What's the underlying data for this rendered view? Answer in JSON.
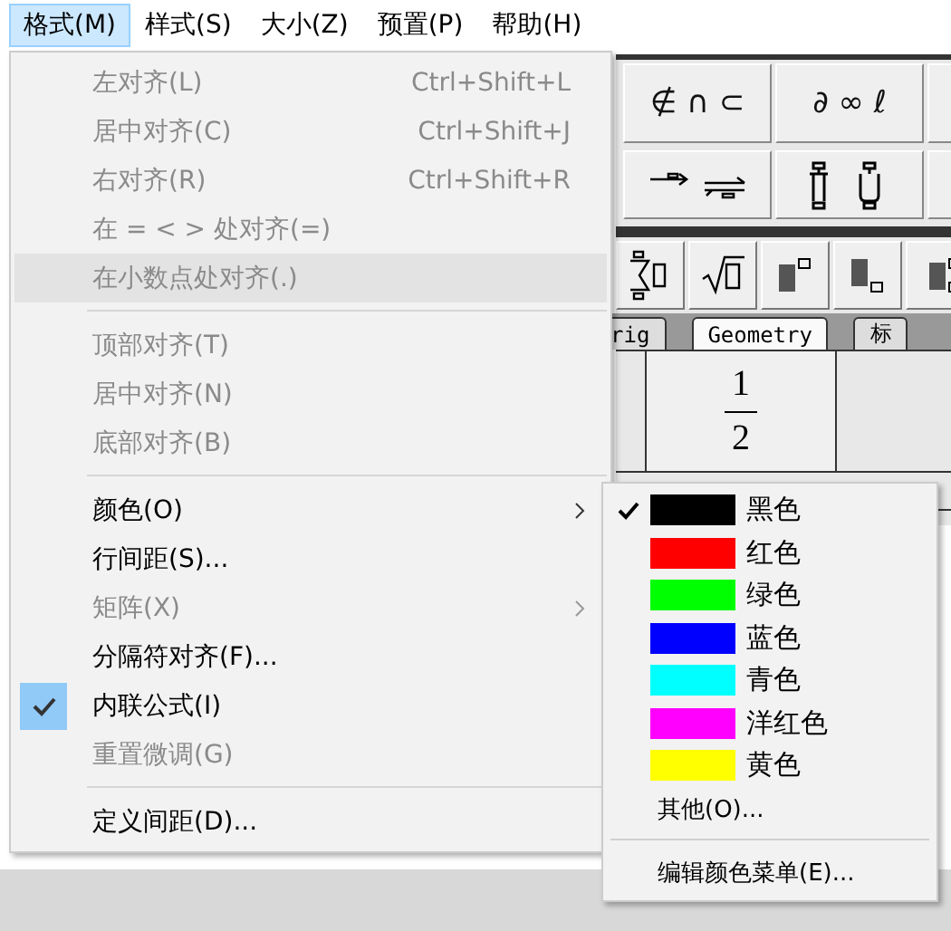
{
  "menu_bar": [
    {
      "label": "格式(M)",
      "selected": true
    },
    {
      "label": "样式(S)",
      "selected": false
    },
    {
      "label": "大小(Z)",
      "selected": false
    },
    {
      "label": "预置(P)",
      "selected": false
    },
    {
      "label": "帮助(H)",
      "selected": false
    }
  ],
  "palette": {
    "symbol_buttons": [
      "∉ ∩ ⊂",
      "∂ ∞ ℓ"
    ],
    "tabs": [
      {
        "label": "rig",
        "selected": false
      },
      {
        "label": "Geometry",
        "selected": true
      },
      {
        "label": "标",
        "selected": false
      }
    ],
    "fraction_template": {
      "numerator": "1",
      "denominator": "2"
    }
  },
  "format_menu": [
    {
      "kind": "item",
      "label": "左对齐(L)",
      "shortcut": "Ctrl+Shift+L",
      "disabled": true,
      "checked": false,
      "submenu": false,
      "highlighted": false
    },
    {
      "kind": "item",
      "label": "居中对齐(C)",
      "shortcut": "Ctrl+Shift+J",
      "disabled": true,
      "checked": false,
      "submenu": false,
      "highlighted": false
    },
    {
      "kind": "item",
      "label": "右对齐(R)",
      "shortcut": "Ctrl+Shift+R",
      "disabled": true,
      "checked": false,
      "submenu": false,
      "highlighted": false
    },
    {
      "kind": "item",
      "label": "在 = < > 处对齐(=)",
      "disabled": true,
      "checked": false,
      "submenu": false,
      "highlighted": false
    },
    {
      "kind": "item",
      "label": "在小数点处对齐(.)",
      "disabled": true,
      "checked": false,
      "submenu": false,
      "highlighted": true
    },
    {
      "kind": "separator"
    },
    {
      "kind": "item",
      "label": "顶部对齐(T)",
      "disabled": true,
      "checked": false,
      "submenu": false,
      "highlighted": false
    },
    {
      "kind": "item",
      "label": "居中对齐(N)",
      "disabled": true,
      "checked": false,
      "submenu": false,
      "highlighted": false
    },
    {
      "kind": "item",
      "label": "底部对齐(B)",
      "disabled": true,
      "checked": false,
      "submenu": false,
      "highlighted": false
    },
    {
      "kind": "separator"
    },
    {
      "kind": "item",
      "label": "颜色(O)",
      "disabled": false,
      "checked": false,
      "submenu": true,
      "highlighted": false
    },
    {
      "kind": "item",
      "label": "行间距(S)...",
      "disabled": false,
      "checked": false,
      "submenu": false,
      "highlighted": false
    },
    {
      "kind": "item",
      "label": "矩阵(X)",
      "disabled": true,
      "checked": false,
      "submenu": true,
      "highlighted": false
    },
    {
      "kind": "item",
      "label": "分隔符对齐(F)...",
      "disabled": false,
      "checked": false,
      "submenu": false,
      "highlighted": false
    },
    {
      "kind": "item",
      "label": "内联公式(I)",
      "disabled": false,
      "checked": true,
      "submenu": false,
      "highlighted": false
    },
    {
      "kind": "item",
      "label": "重置微调(G)",
      "disabled": true,
      "checked": false,
      "submenu": false,
      "highlighted": false
    },
    {
      "kind": "separator"
    },
    {
      "kind": "item",
      "label": "定义间距(D)...",
      "disabled": false,
      "checked": false,
      "submenu": false,
      "highlighted": false
    }
  ],
  "color_menu": [
    {
      "kind": "color",
      "label": "黑色",
      "color": "#000000",
      "checked": true
    },
    {
      "kind": "color",
      "label": "红色",
      "color": "#ff0000",
      "checked": false
    },
    {
      "kind": "color",
      "label": "绿色",
      "color": "#00ff00",
      "checked": false
    },
    {
      "kind": "color",
      "label": "蓝色",
      "color": "#0000ff",
      "checked": false
    },
    {
      "kind": "color",
      "label": "青色",
      "color": "#00ffff",
      "checked": false
    },
    {
      "kind": "color",
      "label": "洋红色",
      "color": "#ff00ff",
      "checked": false
    },
    {
      "kind": "color",
      "label": "黄色",
      "color": "#ffff00",
      "checked": false
    },
    {
      "kind": "item",
      "label": "其他(O)..."
    },
    {
      "kind": "separator"
    },
    {
      "kind": "item",
      "label": "编辑颜色菜单(E)..."
    }
  ]
}
